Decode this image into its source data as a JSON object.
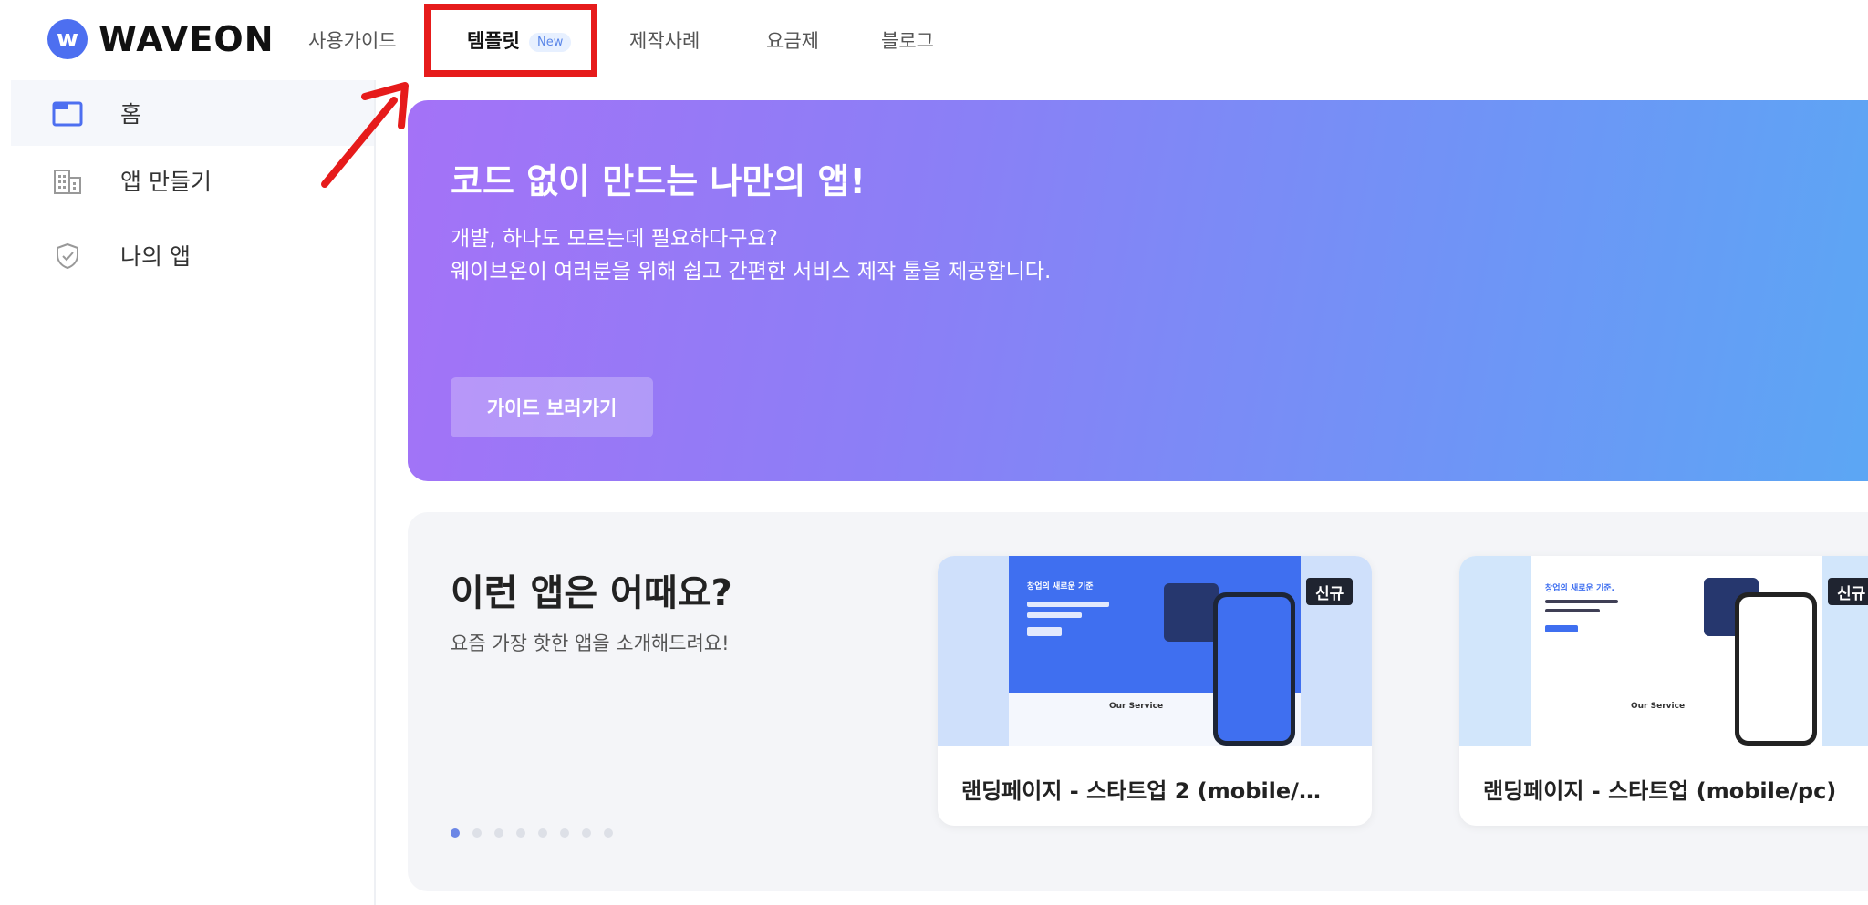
{
  "header": {
    "logo_mark": "w",
    "logo_text": "WAVEON",
    "nav": {
      "guide": "사용가이드",
      "template": "템플릿",
      "template_badge": "New",
      "cases": "제작사례",
      "pricing": "요금제",
      "blog": "블로그"
    }
  },
  "sidebar": {
    "items": [
      {
        "label": "홈",
        "icon": "home-icon"
      },
      {
        "label": "앱 만들기",
        "icon": "building-icon"
      },
      {
        "label": "나의 앱",
        "icon": "shield-check-icon"
      }
    ]
  },
  "hero": {
    "title": "코드 없이 만드는 나만의 앱!",
    "line1": "개발, 하나도 모르는데 필요하다구요?",
    "line2": "웨이브온이 여러분을 위해 쉽고 간편한 서비스 제작 툴을 제공합니다.",
    "button": "가이드 보러가기"
  },
  "recommend": {
    "title": "이런 앱은 어때요?",
    "subtitle": "요즘 가장 핫한 앱을 소개해드려요!",
    "cards": [
      {
        "badge": "신규",
        "title": "랜딩페이지 - 스타트업 2 (mobile/…",
        "thumb_heading": "창업의 새로운 기준",
        "thumb_service": "Our Service"
      },
      {
        "badge": "신규",
        "title": "랜딩페이지 - 스타트업 (mobile/pc)",
        "thumb_heading": "창업의 새로운 기준.",
        "thumb_service": "Our Service"
      }
    ]
  },
  "colors": {
    "highlight": "#e61b1b",
    "brand": "#4d6ff0",
    "hero_start": "#a472f7",
    "hero_end": "#5aa8f4"
  }
}
